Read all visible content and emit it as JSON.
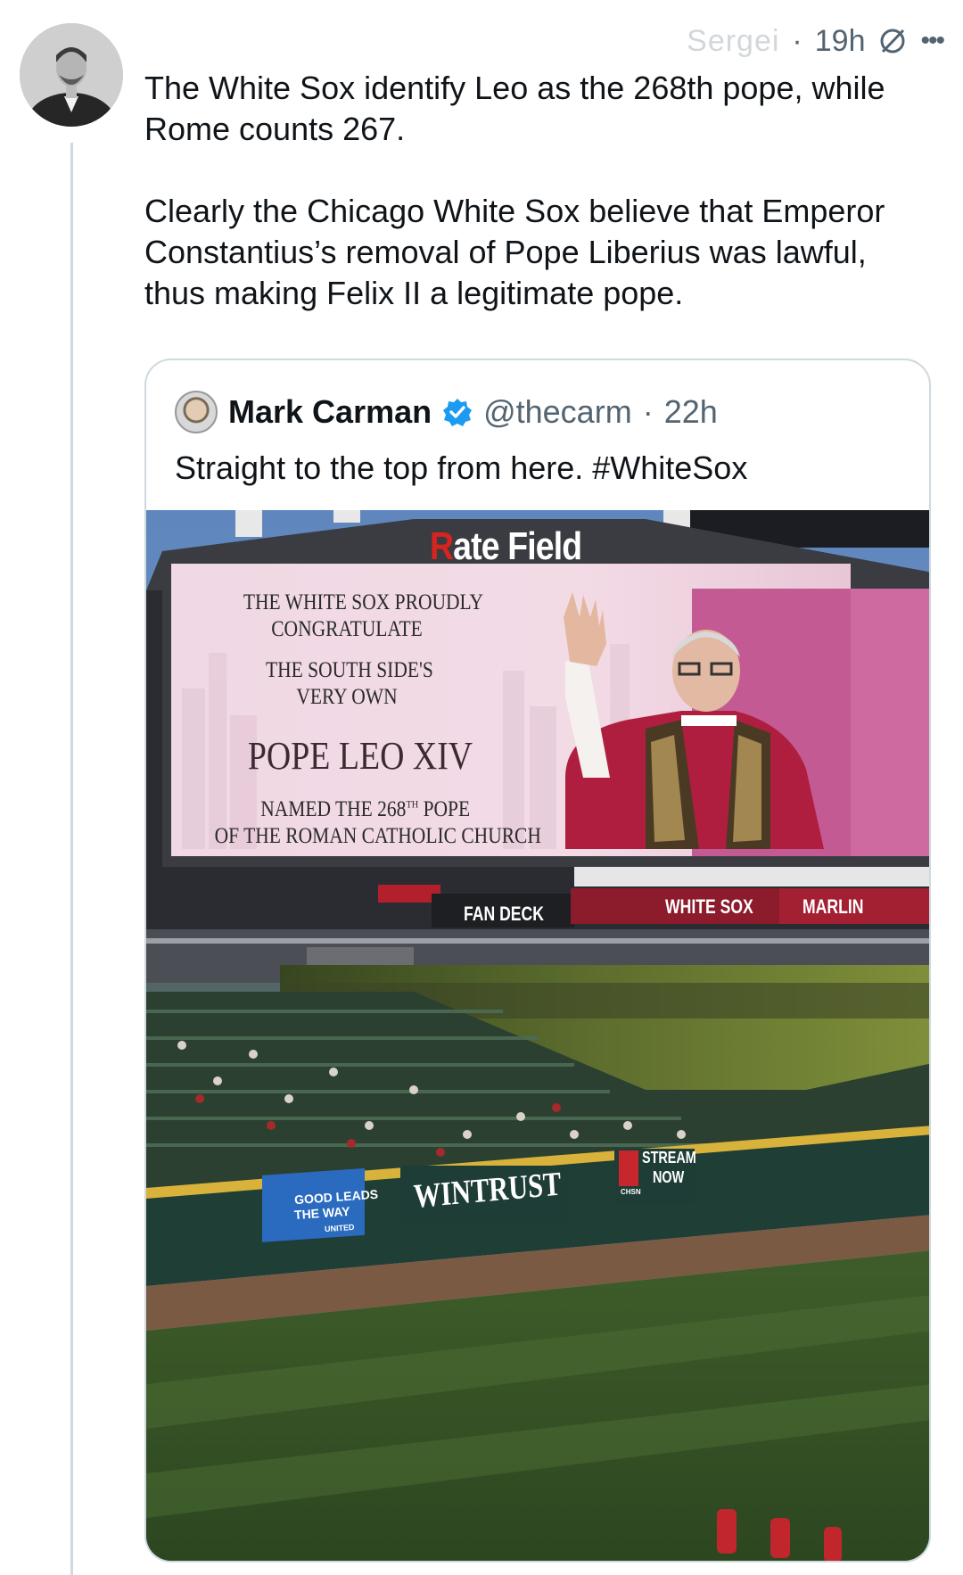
{
  "post": {
    "author_faded": "Sergei",
    "time": "19h",
    "more_icon": "more-icon",
    "paragraph1": "The White Sox identify Leo as the 268th pope, while Rome counts 267.",
    "paragraph2": "Clearly the Chicago White Sox believe that Emperor Constantius’s removal of Pope Liberius was lawful, thus making Felix II a legitimate pope."
  },
  "quote": {
    "name": "Mark Carman",
    "handle": "@thecarm",
    "separator": "·",
    "time": "22h",
    "text": "Straight to the top from here. #WhiteSox",
    "verified_color": "#1d9bf0"
  },
  "photo": {
    "stadium_sign": "Rate Field",
    "stadium_sign_r": "R",
    "stadium_sign_rest": "ate Field",
    "board_line1": "THE WHITE SOX PROUDLY",
    "board_line2": "CONGRATULATE",
    "board_line3": "THE SOUTH SIDE'S",
    "board_line4": "VERY OWN",
    "board_pope": "POPE LEO XIV",
    "board_named": "NAMED THE 268",
    "board_sup": "TH",
    "board_named2": " POPE",
    "board_church": "OF THE ROMAN CATHOLIC CHURCH",
    "fan_deck": "FAN DECK",
    "ribbon_sox": "WHITE SOX",
    "ribbon_marlins": "MARLIN",
    "ad_wintrust": "WINTRUST",
    "ad_united1": "GOOD LEADS",
    "ad_united2": "THE WAY",
    "ad_united3": "UNITED",
    "ad_stream1": "STREAM",
    "ad_stream2": "NOW",
    "ad_chsn": "CHSN"
  }
}
